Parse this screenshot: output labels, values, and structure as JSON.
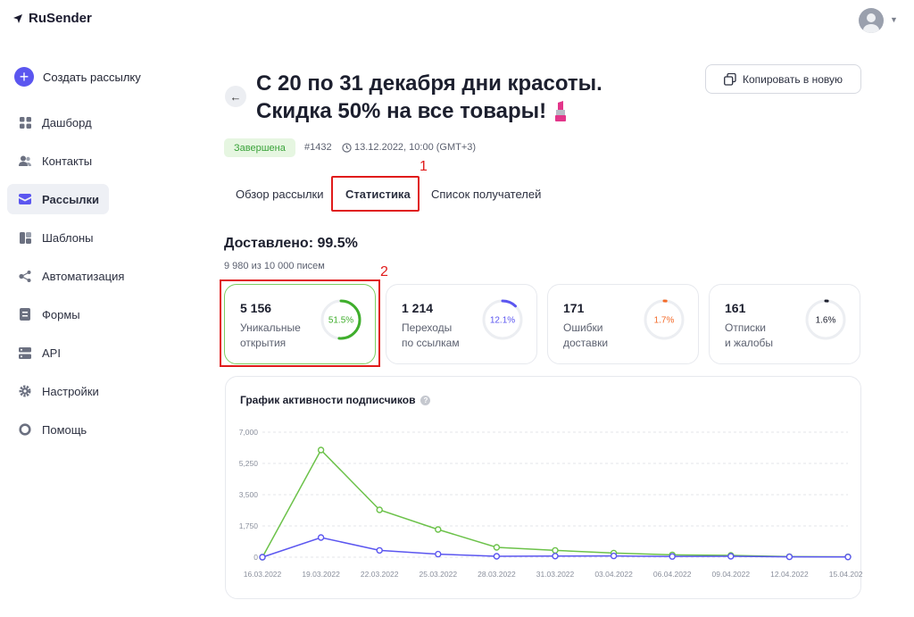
{
  "app": {
    "name": "RuSender"
  },
  "sidebar": {
    "create_label": "Создать рассылку",
    "items": [
      {
        "label": "Дашборд",
        "icon": "dashboard-icon"
      },
      {
        "label": "Контакты",
        "icon": "contacts-icon"
      },
      {
        "label": "Рассылки",
        "icon": "campaigns-icon",
        "active": true
      },
      {
        "label": "Шаблоны",
        "icon": "templates-icon"
      },
      {
        "label": "Автоматизация",
        "icon": "automation-icon"
      },
      {
        "label": "Формы",
        "icon": "forms-icon"
      },
      {
        "label": "API",
        "icon": "api-icon"
      },
      {
        "label": "Настройки",
        "icon": "settings-icon"
      },
      {
        "label": "Помощь",
        "icon": "help-icon"
      }
    ]
  },
  "header": {
    "title_line1": "С 20 по 31 декабря дни красоты.",
    "title_line2": "Скидка 50% на все товары!",
    "copy_label": "Копировать в новую",
    "status": "Завершена",
    "campaign_id": "#1432",
    "date": "13.12.2022, 10:00 (GMT+3)"
  },
  "tabs": [
    {
      "label": "Обзор рассылки",
      "active": false
    },
    {
      "label": "Статистика",
      "active": true
    },
    {
      "label": "Список получателей",
      "active": false
    }
  ],
  "annotations": {
    "tab_marker": "1",
    "card_marker": "2",
    "color": "#e01b1b"
  },
  "delivered": {
    "title": "Доставлено: 99.5%",
    "subtitle": "9 980 из 10 000 писем"
  },
  "stats": [
    {
      "value": "5 156",
      "label1": "Уникальные",
      "label2": "открытия",
      "percent": "51.5%",
      "fraction": 0.515,
      "color": "#3fae2c"
    },
    {
      "value": "1 214",
      "label1": "Переходы",
      "label2": "по ссылкам",
      "percent": "12.1%",
      "fraction": 0.121,
      "color": "#5b56f0"
    },
    {
      "value": "171",
      "label1": "Ошибки",
      "label2": "доставки",
      "percent": "1.7%",
      "fraction": 0.017,
      "color": "#f36b2a"
    },
    {
      "value": "161",
      "label1": "Отписки",
      "label2": "и жалобы",
      "percent": "1.6%",
      "fraction": 0.016,
      "color": "#1c1f2e"
    }
  ],
  "chart_title": "График активности подписчиков",
  "chart_data": {
    "type": "line",
    "x": [
      "16.03.2022",
      "19.03.2022",
      "22.03.2022",
      "25.03.2022",
      "28.03.2022",
      "31.03.2022",
      "03.04.2022",
      "06.04.2022",
      "09.04.2022",
      "12.04.2022",
      "15.04.2022"
    ],
    "y_ticks": [
      "0",
      "1,750",
      "3,500",
      "5,250",
      "7,000"
    ],
    "ylim": [
      0,
      7000
    ],
    "grid": true,
    "series": [
      {
        "values": [
          0,
          6000,
          2650,
          1550,
          550,
          380,
          230,
          130,
          100,
          30,
          20
        ],
        "color": "#6cc24a"
      },
      {
        "values": [
          0,
          1100,
          380,
          170,
          50,
          60,
          70,
          40,
          50,
          20,
          10
        ],
        "color": "#5b56f0"
      }
    ]
  }
}
